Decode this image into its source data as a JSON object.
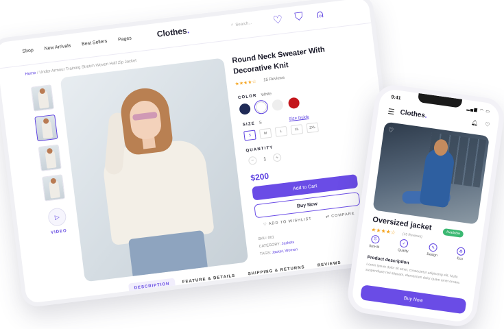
{
  "tablet": {
    "nav": [
      "Shop",
      "New Arrivals",
      "Best Sellers",
      "Pages"
    ],
    "logo": "Clothes",
    "logo_dot": ".",
    "search_placeholder": "Search...",
    "breadcrumb_home": "Home",
    "breadcrumb_sep": "/",
    "breadcrumb_current": "Under Armour Training Stretch Woven Half Zip Jacket",
    "video_label": "VIDEO",
    "product_title": "Round Neck Sweater With Decorative Knit",
    "stars": "★★★★☆",
    "reviews": "15 Reviews",
    "color_label": "COLOR",
    "color_value": "White",
    "colors": [
      "#1f2a56",
      "#ffffff",
      "#eeeeee",
      "#c4161c"
    ],
    "size_label": "SIZE",
    "size_value": "S",
    "size_guide": "Size Guide",
    "sizes": [
      "S",
      "M",
      "L",
      "XL",
      "2XL"
    ],
    "quantity_label": "QUANTITY",
    "quantity": "1",
    "minus": "−",
    "plus": "+",
    "price": "$200",
    "add_to_cart": "Add to Cart",
    "buy_now": "Buy Now",
    "wishlist": "♡  ADD TO WISHLIST",
    "compare": "⇄  COMPARE",
    "sku_label": "SKU: 001",
    "category_label": "CATEGORY:",
    "category_value": "Jackets",
    "tags_label": "TAGS:",
    "tags_value": "Jacket, Women",
    "tabs": [
      "DESCRIPTION",
      "FEATURE & DETAILS",
      "SHIPPING & RETURNS",
      "REVIEWS"
    ],
    "accent": "#5b3fe0"
  },
  "phone": {
    "time": "9:41",
    "status": "▂▄▆ ◠ ▭",
    "logo": "Clothes",
    "logo_dot": ".",
    "title": "Oversized jacket",
    "badge": "Available",
    "stars": "★★★★☆",
    "reviews": "(15 Reviews)",
    "features": [
      {
        "icon": "S",
        "label": "Size M"
      },
      {
        "icon": "✓",
        "label": "Quality"
      },
      {
        "icon": "✎",
        "label": "Design"
      },
      {
        "icon": "♻",
        "label": "Eco"
      }
    ],
    "desc_heading": "Product description",
    "desc": "Lorem ipsum dolor sit amet, consectetur adipiscing elit. Nulla suspendisse nisi aliquam, elementum dolor quam amet ornare.",
    "buy_now": "Buy Now"
  }
}
